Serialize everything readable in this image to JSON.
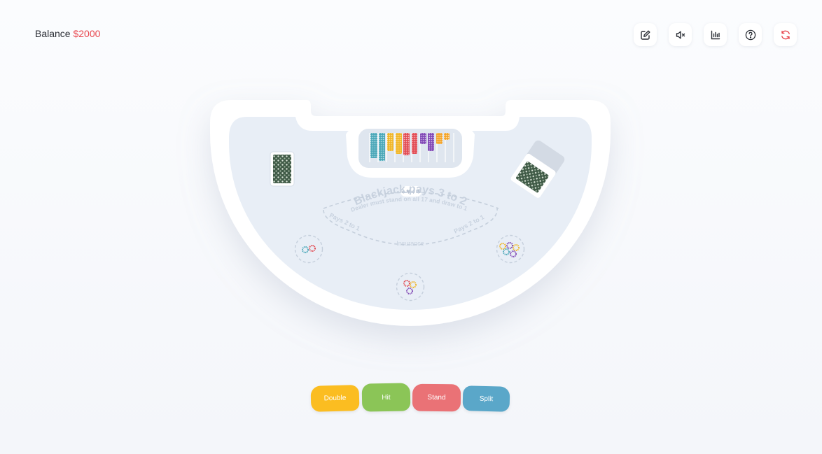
{
  "balance": {
    "label": "Balance",
    "amount": "$2000"
  },
  "toolbar": [
    {
      "name": "edit-icon"
    },
    {
      "name": "mute-icon"
    },
    {
      "name": "stats-icon"
    },
    {
      "name": "help-icon"
    },
    {
      "name": "restart-icon"
    }
  ],
  "table": {
    "main_text": "Blackjack pays 3 to 2",
    "rule_text": "Dealer must stand on all 17 and draw to 16",
    "insurance_left": "Pays 2 to 1",
    "insurance_right": "Pays 2 to 1",
    "insurance_label": "Insurance",
    "suits": "♠♥♦♣"
  },
  "actions": {
    "double": "Double",
    "hit": "Hit",
    "stand": "Stand",
    "split": "Split"
  },
  "colors": {
    "accent_red": "#e8474f",
    "double": "#fbbd21",
    "hit": "#8bc557",
    "stand": "#ea7276",
    "split": "#5aa7c9"
  }
}
